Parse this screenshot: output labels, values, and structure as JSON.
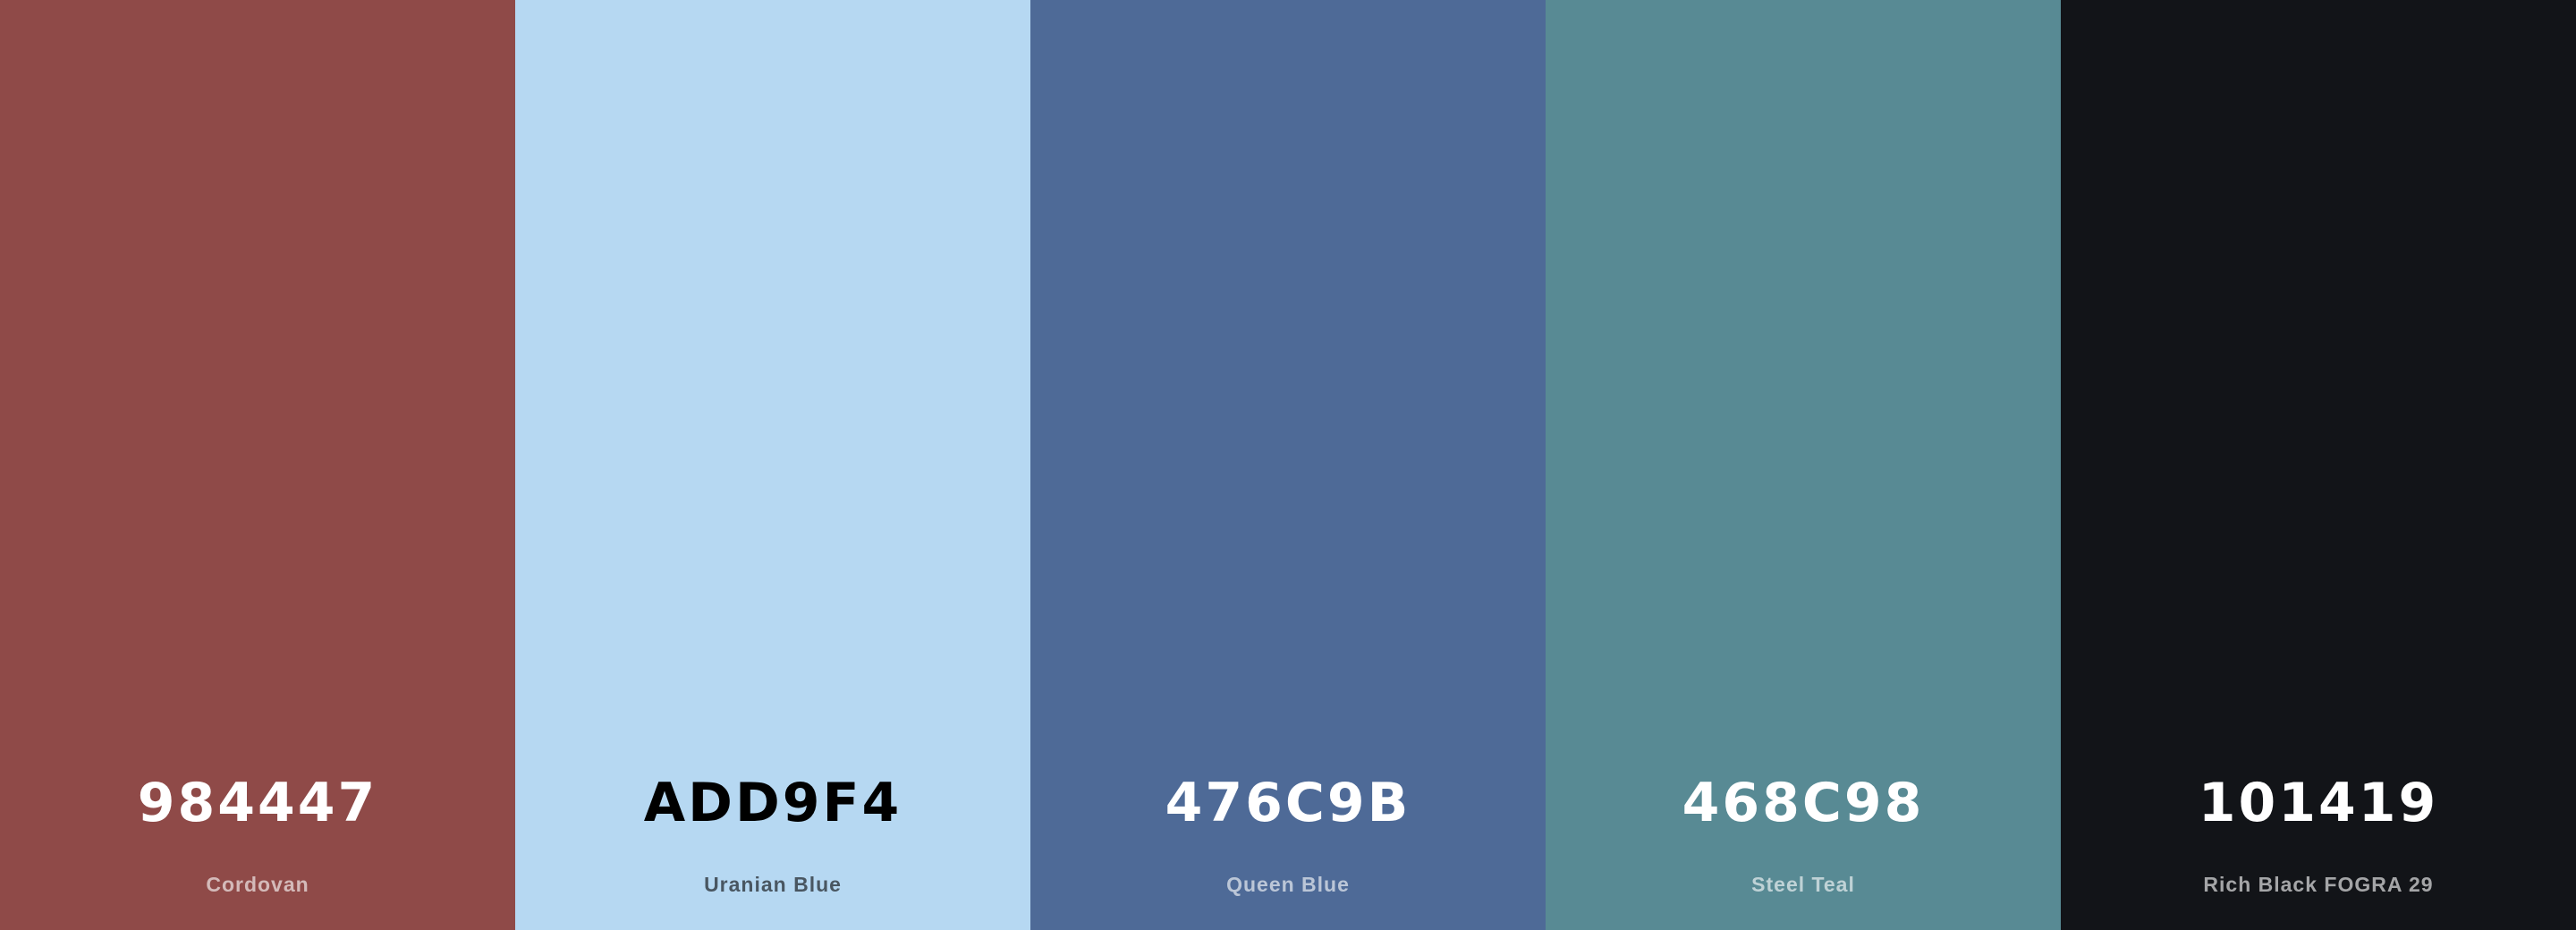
{
  "palette": {
    "colors": [
      {
        "hex": "984447",
        "name": "Cordovan",
        "color": "#8f4a48",
        "text_tone": "light"
      },
      {
        "hex": "ADD9F4",
        "name": "Uranian Blue",
        "color": "#b6d8f2",
        "text_tone": "dark"
      },
      {
        "hex": "476C9B",
        "name": "Queen Blue",
        "color": "#4e6a97",
        "text_tone": "light"
      },
      {
        "hex": "468C98",
        "name": "Steel Teal",
        "color": "#588a94",
        "text_tone": "light"
      },
      {
        "hex": "101419",
        "name": "Rich Black FOGRA 29",
        "color": "#121418",
        "text_tone": "light"
      }
    ]
  }
}
